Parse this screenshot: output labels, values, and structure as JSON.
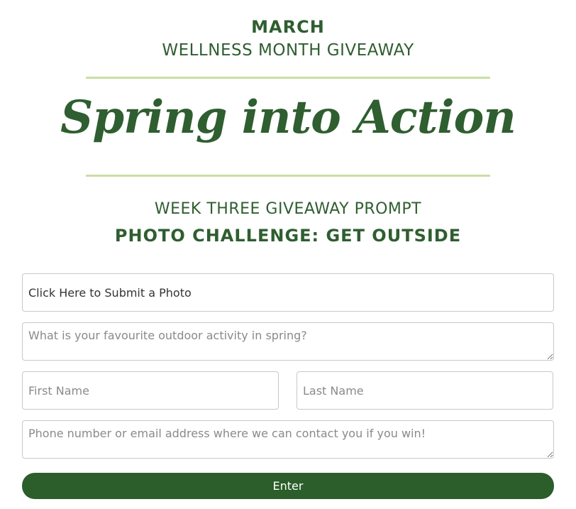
{
  "header": {
    "month": "MARCH",
    "subtitle": "WELLNESS MONTH GIVEAWAY",
    "title": "Spring into Action",
    "week": "WEEK THREE GIVEAWAY PROMPT",
    "challenge": "PHOTO CHALLENGE: GET OUTSIDE"
  },
  "form": {
    "photo_label": "Click Here to Submit a Photo",
    "activity_placeholder": "What is your favourite outdoor activity in spring?",
    "activity_value": "",
    "first_name_placeholder": "First Name",
    "first_name_value": "",
    "last_name_placeholder": "Last Name",
    "last_name_value": "",
    "contact_placeholder": "Phone number or email address where we can contact you if you win!",
    "contact_value": "",
    "submit_label": "Enter"
  },
  "colors": {
    "brand_green": "#2f5e30",
    "rule_green": "#c9dfa6",
    "button_green": "#2b5e2a"
  }
}
